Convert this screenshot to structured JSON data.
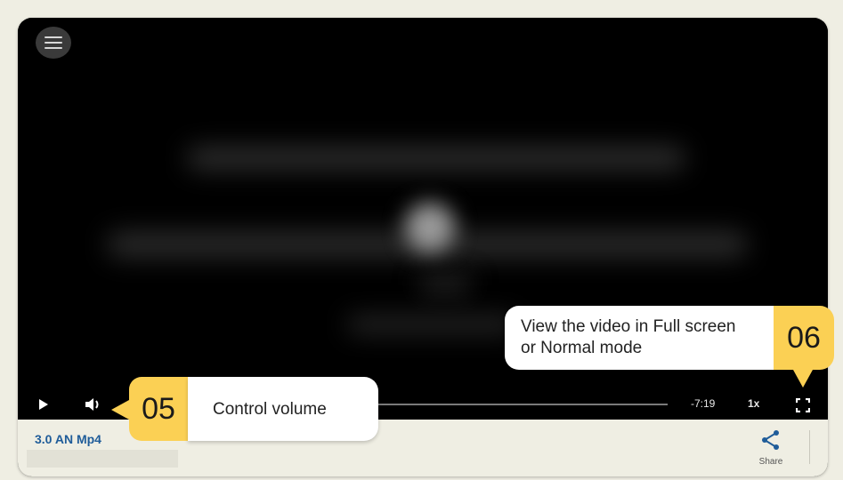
{
  "player": {
    "time_remaining": "-7:19",
    "speed": "1x",
    "title": "3.0 AN Mp4",
    "share_label": "Share"
  },
  "icons": {
    "menu": "hamburger-menu-icon",
    "play": "play-icon",
    "volume": "volume-icon",
    "fullscreen": "fullscreen-icon",
    "share": "share-icon"
  },
  "callouts": [
    {
      "number": "05",
      "text": "Control volume"
    },
    {
      "number": "06",
      "text_line1": "View the video in Full screen",
      "text_line2": "or Normal mode"
    }
  ],
  "colors": {
    "callout_accent": "#fbd054",
    "title_link": "#1f5c99",
    "page_background": "#efeee3"
  }
}
